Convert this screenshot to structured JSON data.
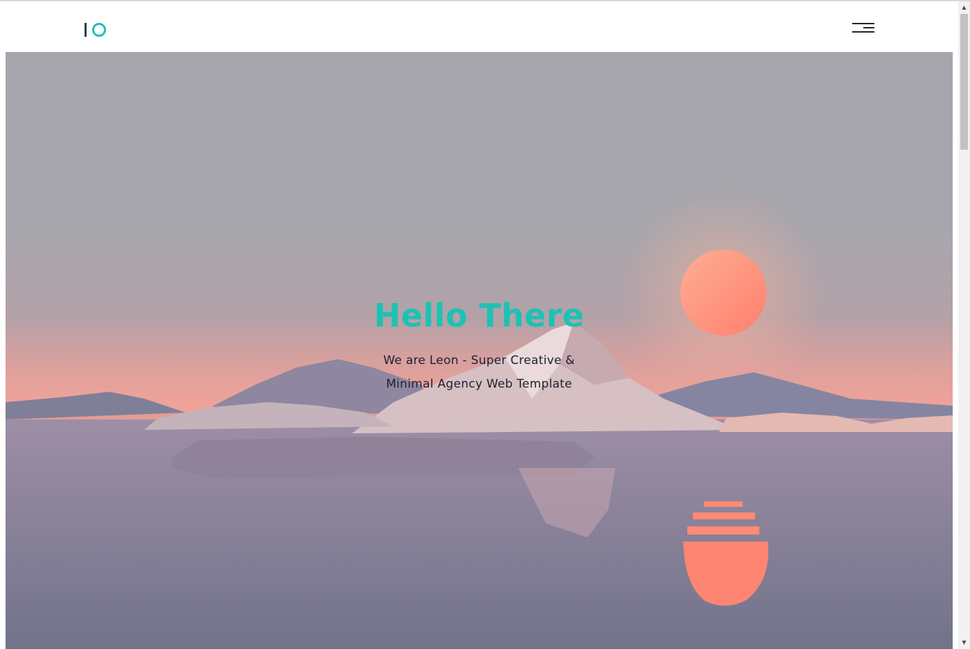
{
  "logo": {
    "alt": "IO"
  },
  "navbar": {
    "menu_icon": "hamburger-menu-icon"
  },
  "hero": {
    "title": "Hello There",
    "subtitle": "We are Leon - Super Creative & Minimal Agency Web Template",
    "title_color": "#1cc2b3",
    "sun_color": "#ff8a73",
    "background_image": "low-poly icebergs on calm sea with setting sun and reflection"
  },
  "scrollbar": {
    "up_icon": "arrow-up-icon",
    "down_icon": "arrow-down-icon"
  }
}
